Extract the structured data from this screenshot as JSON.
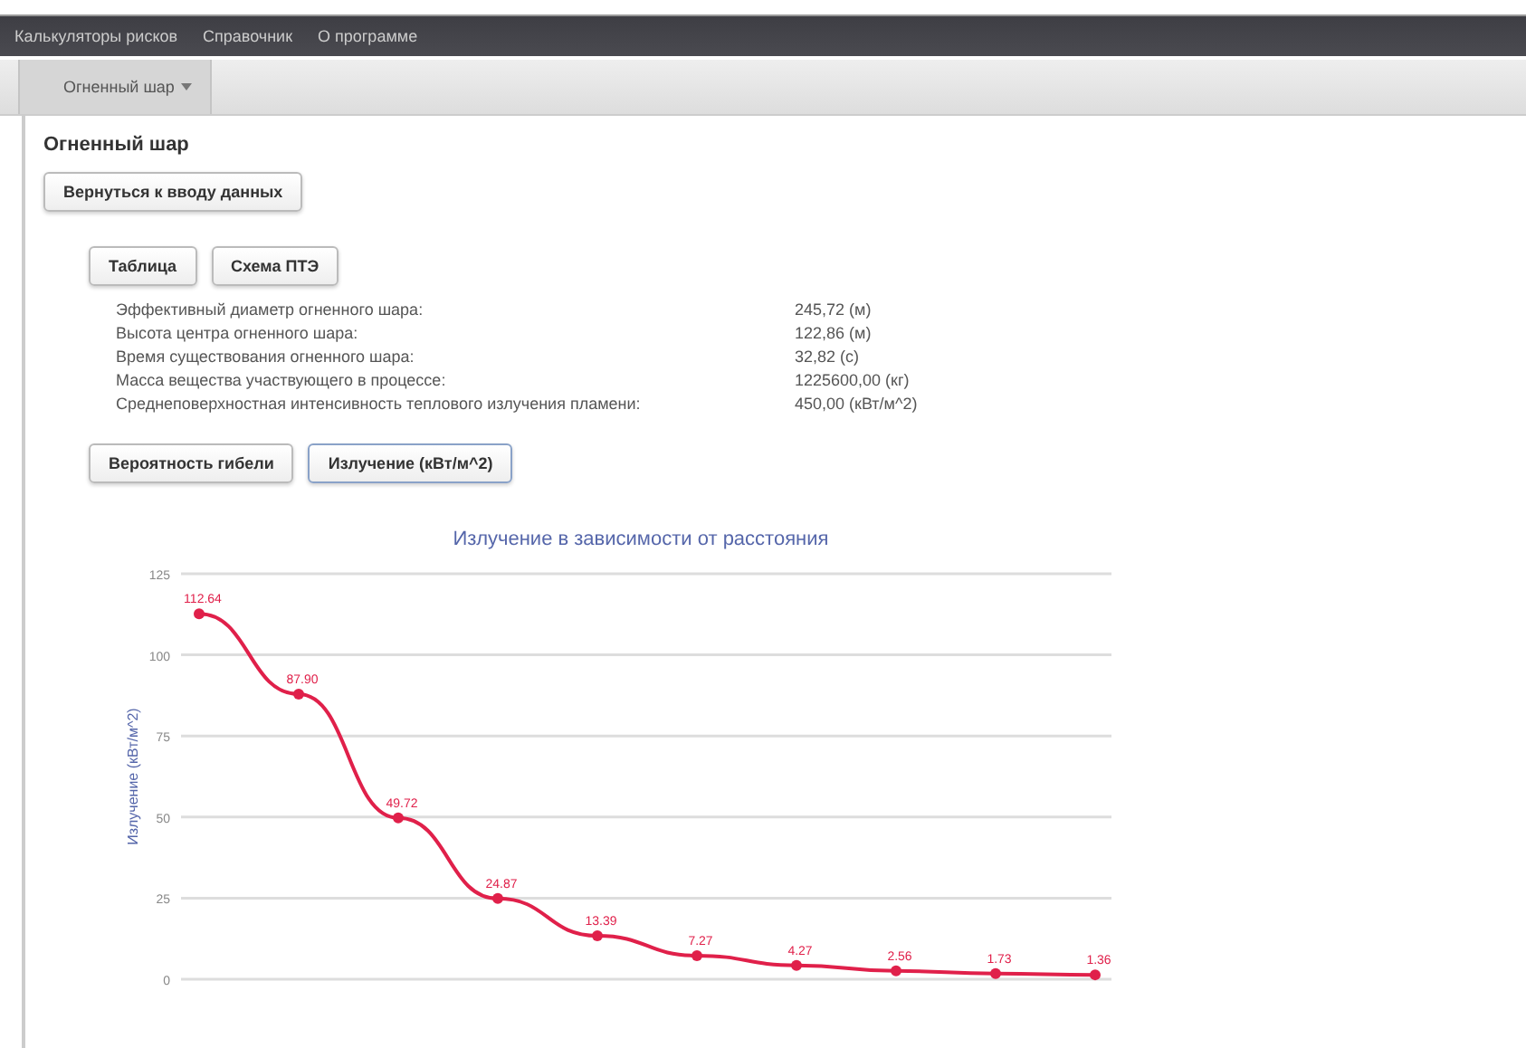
{
  "menu": [
    {
      "label": "Калькуляторы рисков"
    },
    {
      "label": "Справочник"
    },
    {
      "label": "О программе"
    }
  ],
  "tabs": [
    {
      "label": "Огненный шар",
      "selected": true
    }
  ],
  "heading": "Огненный шар",
  "back_button": "Вернуться к вводу данных",
  "view_buttons": [
    {
      "label": "Таблица"
    },
    {
      "label": "Схема ПТЭ"
    }
  ],
  "results": [
    {
      "label": "Эффективный диаметр огненного шара:",
      "value": "245,72 (м)"
    },
    {
      "label": "Высота центра огненного шара:",
      "value": "122,86 (м)"
    },
    {
      "label": "Время существования огненного шара:",
      "value": "32,82 (с)"
    },
    {
      "label": "Масса вещества участвующего в процессе:",
      "value": "1225600,00 (кг)"
    },
    {
      "label": "Среднеповерхностная интенсивность теплового излучения пламени:",
      "value": "450,00 (кВт/м^2)"
    }
  ],
  "chart_tabs": [
    {
      "label": "Вероятность гибели",
      "selected": false
    },
    {
      "label": "Излучение (кВт/м^2)",
      "selected": true
    }
  ],
  "chart": {
    "chart_data": {
      "type": "line",
      "title": "Излучение в зависимости от расстояния",
      "ylabel": "Излучение (кВт/м^2)",
      "ylim": [
        0,
        125
      ],
      "yticks": [
        0,
        25,
        50,
        75,
        100,
        125
      ],
      "grid": true,
      "value_labels": [
        "112.64",
        "87.90",
        "49.72",
        "24.87",
        "13.39",
        "7.27",
        "4.27",
        "2.56",
        "1.73",
        "1.36"
      ],
      "series": [
        {
          "color": "#e0204a",
          "marker": "circle",
          "values": [
            112.64,
            87.9,
            49.72,
            24.87,
            13.39,
            7.27,
            4.27,
            2.56,
            1.73,
            1.36
          ]
        }
      ]
    }
  }
}
